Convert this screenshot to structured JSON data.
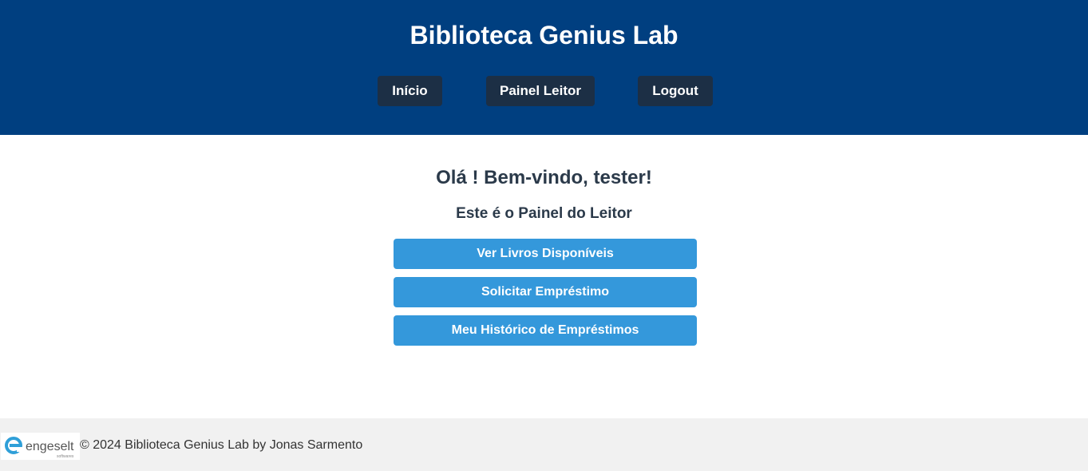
{
  "header": {
    "title": "Biblioteca Genius Lab",
    "nav": [
      {
        "label": "Início"
      },
      {
        "label": "Painel Leitor"
      },
      {
        "label": "Logout"
      }
    ]
  },
  "main": {
    "welcome": "Olá ! Bem-vindo, tester!",
    "subtitle": "Este é o Painel do Leitor",
    "actions": [
      {
        "label": "Ver Livros Disponíveis"
      },
      {
        "label": "Solicitar Empréstimo"
      },
      {
        "label": "Meu Histórico de Empréstimos"
      }
    ]
  },
  "footer": {
    "logo": {
      "name": "engeselt",
      "tagline": "softwares"
    },
    "copyright": "© 2024 Biblioteca Genius Lab by Jonas Sarmento"
  },
  "colors": {
    "header_bg": "#003f80",
    "nav_button_bg": "#1c2f45",
    "action_button_bg": "#3498db",
    "footer_bg": "#f1f1f1",
    "heading_text": "#2b3a4a"
  }
}
